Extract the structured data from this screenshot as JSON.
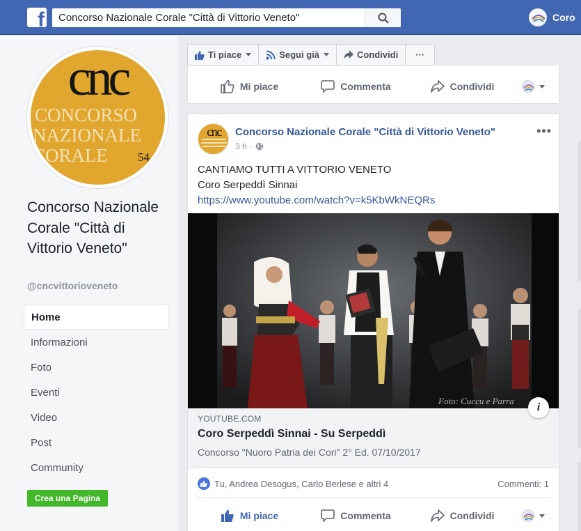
{
  "topbar": {
    "logo_letter": "f",
    "search_value": "Concorso Nazionale Corale \"Città di Vittorio Veneto\"",
    "search_icon": "search-icon",
    "user_name": "Coro"
  },
  "sidebar": {
    "logo_monogram": "CNC",
    "logo_lines": [
      "CONCORSO",
      "NAZIONALE",
      "CORALE"
    ],
    "logo_number": "54",
    "page_name": "Concorso Nazionale Corale \"Città di Vittorio Veneto\"",
    "handle": "@cncvittorioveneto",
    "nav": [
      {
        "label": "Home",
        "active": true
      },
      {
        "label": "Informazioni"
      },
      {
        "label": "Foto"
      },
      {
        "label": "Eventi"
      },
      {
        "label": "Video"
      },
      {
        "label": "Post"
      },
      {
        "label": "Community"
      }
    ],
    "create_page": "Crea una Pagina"
  },
  "action_bar": {
    "like": "Ti piace",
    "follow": "Segui già",
    "share": "Condividi",
    "more": "···"
  },
  "reactions": {
    "like": "Mi piace",
    "comment": "Commenta",
    "share": "Condividi"
  },
  "post": {
    "author": "Concorso Nazionale Corale \"Città di Vittorio Veneto\"",
    "time": "3 h",
    "dot": "·",
    "more": "•••",
    "text_line1": "CANTIAMO TUTTI A VITTORIO VENETO",
    "text_line2": "Coro Serpeddì Sinnai",
    "link": "https://www.youtube.com/watch?v=k5KbWkNEQRs",
    "card": {
      "domain": "YOUTUBE.COM",
      "title": "Coro Serpeddì Sinnai - Su Serpeddì",
      "description": "Concorso \"Nuoro Patria dei Cori\" 2° Ed. 07/10/2017"
    },
    "info_icon": "i",
    "likes_text": "Tu, Andrea Desogus, Carlo Berlese e altri 4",
    "comments_text": "Commenti: 1"
  },
  "colors": {
    "brand": "#4267b2",
    "link": "#365899",
    "cta_green": "#42b72a",
    "logo_gold": "#e0a62d"
  }
}
